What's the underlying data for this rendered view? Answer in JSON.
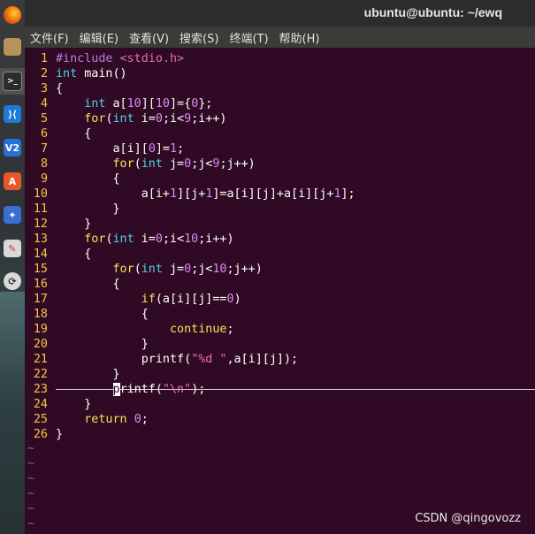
{
  "window": {
    "title": "ubuntu@ubuntu: ~/ewq"
  },
  "menu": [
    "文件(F)",
    "编辑(E)",
    "查看(V)",
    "搜索(S)",
    "终端(T)",
    "帮助(H)"
  ],
  "dock": [
    {
      "name": "firefox-icon",
      "glyph": "",
      "color": "#e66000"
    },
    {
      "name": "files-icon",
      "glyph": "",
      "color": "#b5935a"
    },
    {
      "name": "terminal-icon",
      "glyph": ">_",
      "color": "#2b2b2b"
    },
    {
      "name": "vscode-icon",
      "glyph": "⟩⟨",
      "color": "#1e7ad6"
    },
    {
      "name": "v2ray-icon",
      "glyph": "V2",
      "color": "#2a6fd8"
    },
    {
      "name": "software-center-icon",
      "glyph": "A",
      "color": "#e8562a"
    },
    {
      "name": "network-icon",
      "glyph": "✦",
      "color": "#3a6ed0"
    },
    {
      "name": "text-editor-icon",
      "glyph": "✎",
      "color": "#d9d9d9"
    },
    {
      "name": "updater-icon",
      "glyph": "⟳",
      "color": "#555555"
    }
  ],
  "editor": {
    "lines": [
      {
        "n": "1",
        "t": [
          [
            "#include ",
            "pp"
          ],
          [
            "<stdio.h>",
            "st"
          ]
        ]
      },
      {
        "n": "2",
        "t": [
          [
            "int",
            "kw"
          ],
          [
            " main()",
            ""
          ]
        ]
      },
      {
        "n": "3",
        "t": [
          [
            "{",
            ""
          ]
        ]
      },
      {
        "n": "4",
        "t": [
          [
            "    ",
            ""
          ],
          [
            "int",
            "kw"
          ],
          [
            " a[",
            ""
          ],
          [
            "10",
            "nm"
          ],
          [
            "][",
            ""
          ],
          [
            "10",
            "nm"
          ],
          [
            "]={",
            ""
          ],
          [
            "0",
            "nm"
          ],
          [
            "};",
            ""
          ]
        ]
      },
      {
        "n": "5",
        "t": [
          [
            "    ",
            ""
          ],
          [
            "for",
            "yl"
          ],
          [
            "(",
            ""
          ],
          [
            "int",
            "kw"
          ],
          [
            " i=",
            ""
          ],
          [
            "0",
            "nm"
          ],
          [
            ";i<",
            ""
          ],
          [
            "9",
            "nm"
          ],
          [
            ";i++)",
            ""
          ]
        ]
      },
      {
        "n": "6",
        "t": [
          [
            "    {",
            ""
          ]
        ]
      },
      {
        "n": "7",
        "t": [
          [
            "        a[i][",
            ""
          ],
          [
            "0",
            "nm"
          ],
          [
            "]=",
            ""
          ],
          [
            "1",
            "nm"
          ],
          [
            ";",
            ""
          ]
        ]
      },
      {
        "n": "8",
        "t": [
          [
            "        ",
            ""
          ],
          [
            "for",
            "yl"
          ],
          [
            "(",
            ""
          ],
          [
            "int",
            "kw"
          ],
          [
            " j=",
            ""
          ],
          [
            "0",
            "nm"
          ],
          [
            ";j<",
            ""
          ],
          [
            "9",
            "nm"
          ],
          [
            ";j++)",
            ""
          ]
        ]
      },
      {
        "n": "9",
        "t": [
          [
            "        {",
            ""
          ]
        ]
      },
      {
        "n": "10",
        "t": [
          [
            "            a[i+",
            ""
          ],
          [
            "1",
            "nm"
          ],
          [
            "][j+",
            ""
          ],
          [
            "1",
            "nm"
          ],
          [
            "]=a[i][j]+a[i][j+",
            ""
          ],
          [
            "1",
            "nm"
          ],
          [
            "];",
            ""
          ]
        ]
      },
      {
        "n": "11",
        "t": [
          [
            "        }",
            ""
          ]
        ]
      },
      {
        "n": "12",
        "t": [
          [
            "    }",
            ""
          ]
        ]
      },
      {
        "n": "13",
        "t": [
          [
            "    ",
            ""
          ],
          [
            "for",
            "yl"
          ],
          [
            "(",
            ""
          ],
          [
            "int",
            "kw"
          ],
          [
            " i=",
            ""
          ],
          [
            "0",
            "nm"
          ],
          [
            ";i<",
            ""
          ],
          [
            "10",
            "nm"
          ],
          [
            ";i++)",
            ""
          ]
        ]
      },
      {
        "n": "14",
        "t": [
          [
            "    {",
            ""
          ]
        ]
      },
      {
        "n": "15",
        "t": [
          [
            "        ",
            ""
          ],
          [
            "for",
            "yl"
          ],
          [
            "(",
            ""
          ],
          [
            "int",
            "kw"
          ],
          [
            " j=",
            ""
          ],
          [
            "0",
            "nm"
          ],
          [
            ";j<",
            ""
          ],
          [
            "10",
            "nm"
          ],
          [
            ";j++)",
            ""
          ]
        ]
      },
      {
        "n": "16",
        "t": [
          [
            "        {",
            ""
          ]
        ]
      },
      {
        "n": "17",
        "t": [
          [
            "            ",
            ""
          ],
          [
            "if",
            "yl"
          ],
          [
            "(a[i][j]==",
            ""
          ],
          [
            "0",
            "nm"
          ],
          [
            ")",
            ""
          ]
        ]
      },
      {
        "n": "18",
        "t": [
          [
            "            {",
            ""
          ]
        ]
      },
      {
        "n": "19",
        "t": [
          [
            "                ",
            ""
          ],
          [
            "continue",
            "yl"
          ],
          [
            ";",
            ""
          ]
        ]
      },
      {
        "n": "20",
        "t": [
          [
            "            }",
            ""
          ]
        ]
      },
      {
        "n": "21",
        "t": [
          [
            "            printf(",
            ""
          ],
          [
            "\"%d \"",
            "st"
          ],
          [
            ",a[i][j]);",
            ""
          ]
        ]
      },
      {
        "n": "22",
        "t": [
          [
            "        }",
            ""
          ]
        ]
      },
      {
        "n": "23",
        "t": [
          [
            "        ",
            ""
          ],
          [
            "p",
            "cursor"
          ],
          [
            "rintf(",
            ""
          ],
          [
            "\"\\n\"",
            "st"
          ],
          [
            ");",
            ""
          ]
        ]
      },
      {
        "n": "24",
        "t": [
          [
            "    }",
            ""
          ]
        ]
      },
      {
        "n": "25",
        "t": [
          [
            "    ",
            ""
          ],
          [
            "return",
            "yl"
          ],
          [
            " ",
            ""
          ],
          [
            "0",
            "nm"
          ],
          [
            ";",
            ""
          ]
        ]
      },
      {
        "n": "26",
        "t": [
          [
            "}",
            ""
          ]
        ]
      }
    ],
    "tildes": [
      "~",
      "~",
      "~",
      "~",
      "~",
      "~"
    ]
  },
  "watermark": "CSDN @qingovozz"
}
